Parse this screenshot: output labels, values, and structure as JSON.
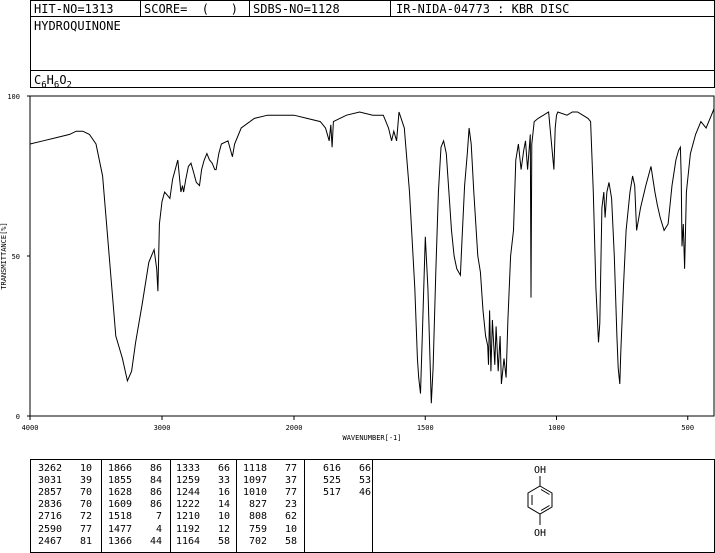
{
  "header": {
    "hit_no": "HIT-NO=1313",
    "score": "SCORE=  (   )",
    "sdbs_no": "SDBS-NO=1128",
    "ir_id": "IR-NIDA-04773 : KBR DISC"
  },
  "compound": {
    "name": "HYDROQUINONE",
    "formula": "C6H6O2"
  },
  "structure": {
    "top_label": "OH",
    "bottom_label": "OH"
  },
  "chart_data": {
    "type": "line",
    "title": "",
    "xlabel": "WAVENUMBER[-1]",
    "ylabel": "TRANSMITTANCE[%]",
    "xlim": [
      4000,
      400
    ],
    "ylim": [
      0,
      100
    ],
    "x_ticks": [
      "4000",
      "3000",
      "2000",
      "1500",
      "1000",
      "500"
    ],
    "y_ticks": [
      "100",
      "50",
      "0"
    ],
    "grid": false,
    "series": [
      {
        "x": [
          4000,
          3900,
          3800,
          3700,
          3650,
          3600,
          3550,
          3500,
          3450,
          3400,
          3350,
          3300,
          3262,
          3230,
          3200,
          3150,
          3100,
          3080,
          3060,
          3040,
          3031,
          3020,
          3000,
          2980,
          2960,
          2940,
          2920,
          2900,
          2880,
          2857,
          2845,
          2836,
          2820,
          2800,
          2780,
          2760,
          2740,
          2716,
          2700,
          2680,
          2660,
          2640,
          2620,
          2600,
          2590,
          2570,
          2550,
          2500,
          2467,
          2450,
          2400,
          2300,
          2200,
          2100,
          2000,
          1950,
          1900,
          1880,
          1866,
          1860,
          1855,
          1850,
          1800,
          1750,
          1700,
          1660,
          1640,
          1628,
          1620,
          1609,
          1600,
          1580,
          1560,
          1540,
          1530,
          1525,
          1518,
          1510,
          1500,
          1490,
          1477,
          1470,
          1460,
          1450,
          1440,
          1430,
          1420,
          1410,
          1400,
          1390,
          1380,
          1366,
          1360,
          1350,
          1340,
          1333,
          1325,
          1315,
          1300,
          1290,
          1280,
          1270,
          1262,
          1259,
          1255,
          1250,
          1244,
          1235,
          1230,
          1222,
          1215,
          1210,
          1200,
          1192,
          1185,
          1175,
          1164,
          1155,
          1145,
          1135,
          1125,
          1118,
          1110,
          1100,
          1097,
          1094,
          1085,
          1070,
          1050,
          1030,
          1010,
          1005,
          1000,
          995,
          960,
          940,
          920,
          900,
          880,
          870,
          860,
          850,
          840,
          835,
          827,
          820,
          815,
          808,
          800,
          790,
          780,
          770,
          765,
          759,
          755,
          745,
          735,
          720,
          710,
          702,
          695,
          680,
          660,
          640,
          625,
          616,
          605,
          590,
          575,
          560,
          545,
          535,
          528,
          525,
          522,
          517,
          512,
          505,
          490,
          470,
          450,
          430,
          410,
          400
        ],
        "values": [
          85,
          86,
          87,
          88,
          89,
          89,
          88,
          85,
          75,
          50,
          25,
          18,
          11,
          14,
          23,
          35,
          48,
          50,
          52,
          46,
          39,
          60,
          67,
          70,
          69,
          68,
          74,
          77,
          80,
          70,
          72,
          70,
          74,
          78,
          79,
          76,
          73,
          72,
          77,
          80,
          82,
          80,
          79,
          77,
          77,
          82,
          85,
          86,
          81,
          85,
          90,
          93,
          94,
          94,
          94,
          93,
          92,
          90,
          86,
          91,
          84,
          92,
          94,
          95,
          94,
          94,
          90,
          86,
          89,
          86,
          95,
          90,
          70,
          40,
          18,
          12,
          7,
          28,
          56,
          40,
          4,
          15,
          45,
          70,
          84,
          86,
          82,
          70,
          58,
          50,
          46,
          44,
          55,
          72,
          82,
          90,
          85,
          70,
          50,
          45,
          33,
          25,
          22,
          16,
          33,
          14,
          30,
          16,
          28,
          14,
          25,
          10,
          18,
          12,
          30,
          50,
          58,
          80,
          85,
          77,
          83,
          86,
          77,
          88,
          37,
          85,
          92,
          93,
          94,
          95,
          77,
          90,
          94,
          95,
          94,
          95,
          95,
          94,
          93,
          92,
          70,
          40,
          23,
          29,
          65,
          70,
          62,
          70,
          73,
          68,
          50,
          25,
          15,
          10,
          20,
          40,
          58,
          70,
          75,
          72,
          58,
          65,
          72,
          78,
          70,
          66,
          62,
          58,
          60,
          72,
          80,
          83,
          84,
          75,
          53,
          60,
          46,
          70,
          82,
          88,
          92,
          90,
          94,
          96
        ]
      }
    ]
  },
  "peaks": {
    "columns": [
      [
        [
          "3262",
          "10"
        ],
        [
          "3031",
          "39"
        ],
        [
          "2857",
          "70"
        ],
        [
          "2836",
          "70"
        ],
        [
          "2716",
          "72"
        ],
        [
          "2590",
          "77"
        ],
        [
          "2467",
          "81"
        ]
      ],
      [
        [
          "1866",
          "86"
        ],
        [
          "1855",
          "84"
        ],
        [
          "1628",
          "86"
        ],
        [
          "1609",
          "86"
        ],
        [
          "1518",
          "7"
        ],
        [
          "1477",
          "4"
        ],
        [
          "1366",
          "44"
        ]
      ],
      [
        [
          "1333",
          "66"
        ],
        [
          "1259",
          "33"
        ],
        [
          "1244",
          "16"
        ],
        [
          "1222",
          "14"
        ],
        [
          "1210",
          "10"
        ],
        [
          "1192",
          "12"
        ],
        [
          "1164",
          "58"
        ]
      ],
      [
        [
          "1118",
          "77"
        ],
        [
          "1097",
          "37"
        ],
        [
          "1010",
          "77"
        ],
        [
          "827",
          "23"
        ],
        [
          "808",
          "62"
        ],
        [
          "759",
          "10"
        ],
        [
          "702",
          "58"
        ]
      ],
      [
        [
          "616",
          "66"
        ],
        [
          "525",
          "53"
        ],
        [
          "517",
          "46"
        ]
      ]
    ]
  }
}
